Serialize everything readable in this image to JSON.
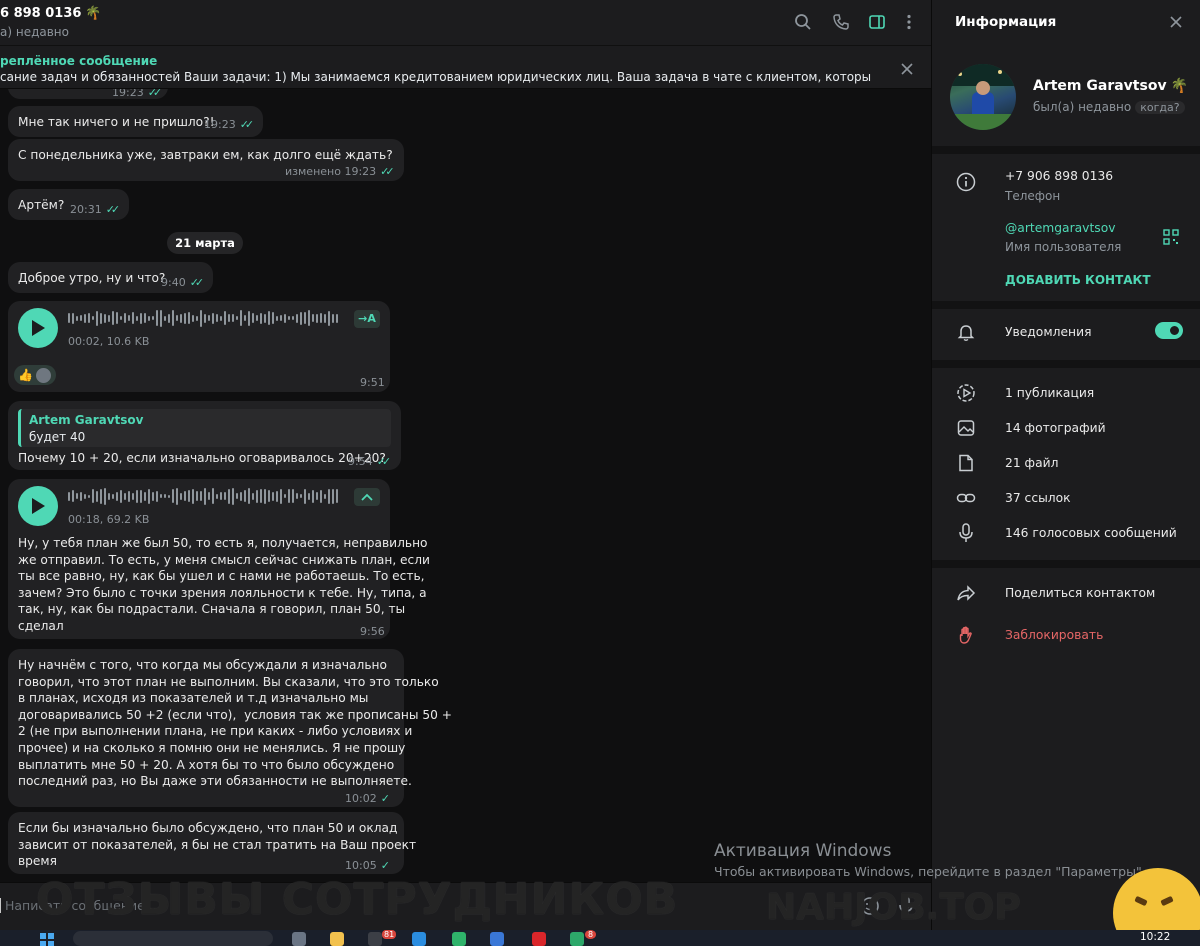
{
  "header": {
    "title": "6 898 0136",
    "title_icon": "palm-icon",
    "status": "а) недавно"
  },
  "pinned": {
    "title": "реплённое сообщение",
    "text": "сание задач и обязанностей Ваши задачи: 1) Мы занимаемся кредитованием юридических лиц. Ваша задача в чате с клиентом, который уже подписа..."
  },
  "messages": {
    "m0": {
      "time": "19:23"
    },
    "m1": {
      "text": "Мне так ничего и не пришло?!",
      "time": "19:23"
    },
    "m2": {
      "text": "С понедельника уже, завтраки ем, как долго ещё ждать?",
      "time": "изменено 19:23"
    },
    "m3": {
      "text": "Артём?",
      "time": "20:31"
    },
    "date": "21 марта",
    "m4": {
      "text": "Доброе утро, ну и что?",
      "time": "9:40"
    },
    "m5": {
      "voice_info": "00:02, 10.6 KB",
      "transcribe": "→A",
      "time": "9:51"
    },
    "m6": {
      "reply_name": "Artem Garavtsov",
      "reply_text": "будет 40",
      "text": "Почему 10 + 20, если изначально оговаривалось 20+20?",
      "time": "9:54"
    },
    "m7": {
      "voice_info": "00:18, 69.2 KB",
      "transcript": "Ну, у тебя план же был 50, то есть я, получается, неправильно\nже отправил. То есть, у меня смысл сейчас снижать план, если\nты все равно, ну, как бы ушел и с нами не работаешь. То есть,\nзачем? Это было с точки зрения лояльности к тебе. Ну, типа, а\nтак, ну, как бы подрастали. Сначала я говорил, план 50, ты\nсделал",
      "time": "9:56"
    },
    "m8": {
      "text": "Ну начнём с того, что когда мы обсуждали я изначально\nговорил, что этот план не выполним. Вы сказали, что это только\nв планах, исходя из показателей и т.д изначально мы\nдоговаривались 50 +2 (если что),  условия так же прописаны 50 +\n2 (не при выполнении плана, не при каких - либо условиях и\nпрочее) и на сколько я помню они не менялись. Я не прошу\nвыплатить мне 50 + 20. А хотя бы то что было обсуждено\nпоследний раз, но Вы даже эти обязанности не выполняете.",
      "time": "10:02"
    },
    "m9": {
      "text": "Если бы изначально было обсуждено, что план 50 и оклад\nзависит от показателей, я бы не стал тратить на Ваш проект\nвремя",
      "time": "10:05"
    }
  },
  "composer": {
    "placeholder": "Написать сообщение..."
  },
  "info": {
    "title": "Информация",
    "name": "Artem Garavtsov",
    "status": "был(а) недавно",
    "when_chip": "когда?",
    "phone": "+7 906 898 0136",
    "phone_label": "Телефон",
    "username": "@artemgaravtsov",
    "username_label": "Имя пользователя",
    "add_contact": "ДОБАВИТЬ КОНТАКТ",
    "notifications": "Уведомления",
    "notifications_on": true,
    "media": [
      "1 публикация",
      "14 фотографий",
      "21 файл",
      "37 ссылок",
      "146 голосовых сообщений"
    ],
    "share": "Поделиться контактом",
    "block": "Заблокировать"
  },
  "watermarks": {
    "activation_title": "Активация Windows",
    "activation_text": "Чтобы активировать Windows, перейдите в раздел \"Параметры\".",
    "reviews": "ОТЗЫВЫ СОТРУДНИКОВ",
    "site": "NAHJOB.TOP"
  },
  "taskbar": {
    "time": "10:22",
    "badge1": "81",
    "badge2": "8"
  },
  "colors": {
    "accent": "#4fd8b5",
    "bubble": "#212123",
    "panel": "#1c1c1e",
    "danger": "#e56666"
  }
}
